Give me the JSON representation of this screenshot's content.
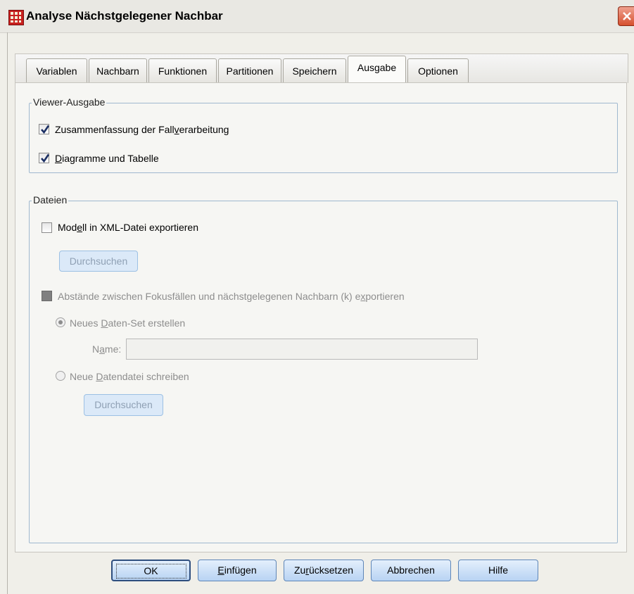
{
  "window": {
    "title": "Analyse Nächstgelegener Nachbar",
    "icon": "spss-table-icon",
    "close_icon": "close-icon"
  },
  "tabs": [
    {
      "label": "Variablen"
    },
    {
      "label": "Nachbarn"
    },
    {
      "label": "Funktionen"
    },
    {
      "label": "Partitionen"
    },
    {
      "label": "Speichern"
    },
    {
      "label": "Ausgabe",
      "active": true
    },
    {
      "label": "Optionen"
    }
  ],
  "viewer_group": {
    "legend": "Viewer-Ausgabe",
    "case_summary": {
      "pre": "Zusammenfassung der Fall",
      "key": "v",
      "post": "erarbeitung",
      "checked": true
    },
    "charts_tables": {
      "pre": "",
      "key": "D",
      "post": "iagramme und Tabelle",
      "checked": true
    }
  },
  "files_group": {
    "legend": "Dateien",
    "export_xml": {
      "pre": "Mod",
      "key": "e",
      "post": "ll in XML-Datei exportieren",
      "checked": false
    },
    "browse1": "Durchsuchen",
    "export_distances": {
      "pre": "Abstände zwischen Fokusfällen und nächstgelegenen Nachbarn (k) e",
      "key": "x",
      "post": "portieren",
      "checked": false,
      "enabled": false
    },
    "new_dataset": {
      "pre": "Neues ",
      "key": "D",
      "post": "aten-Set erstellen",
      "selected": true
    },
    "name_label": {
      "pre": "N",
      "key": "a",
      "post": "me:"
    },
    "name_value": "",
    "new_datafile": {
      "pre": "Neue ",
      "key": "D",
      "post": "atendatei schreiben",
      "selected": false
    },
    "browse2": "Durchsuchen"
  },
  "footer": {
    "ok": "OK",
    "paste": {
      "pre": "",
      "key": "E",
      "post": "infügen"
    },
    "reset": {
      "pre": "Zu",
      "key": "r",
      "post": "ücksetzen"
    },
    "cancel": "Abbrechen",
    "help": "Hilfe"
  }
}
